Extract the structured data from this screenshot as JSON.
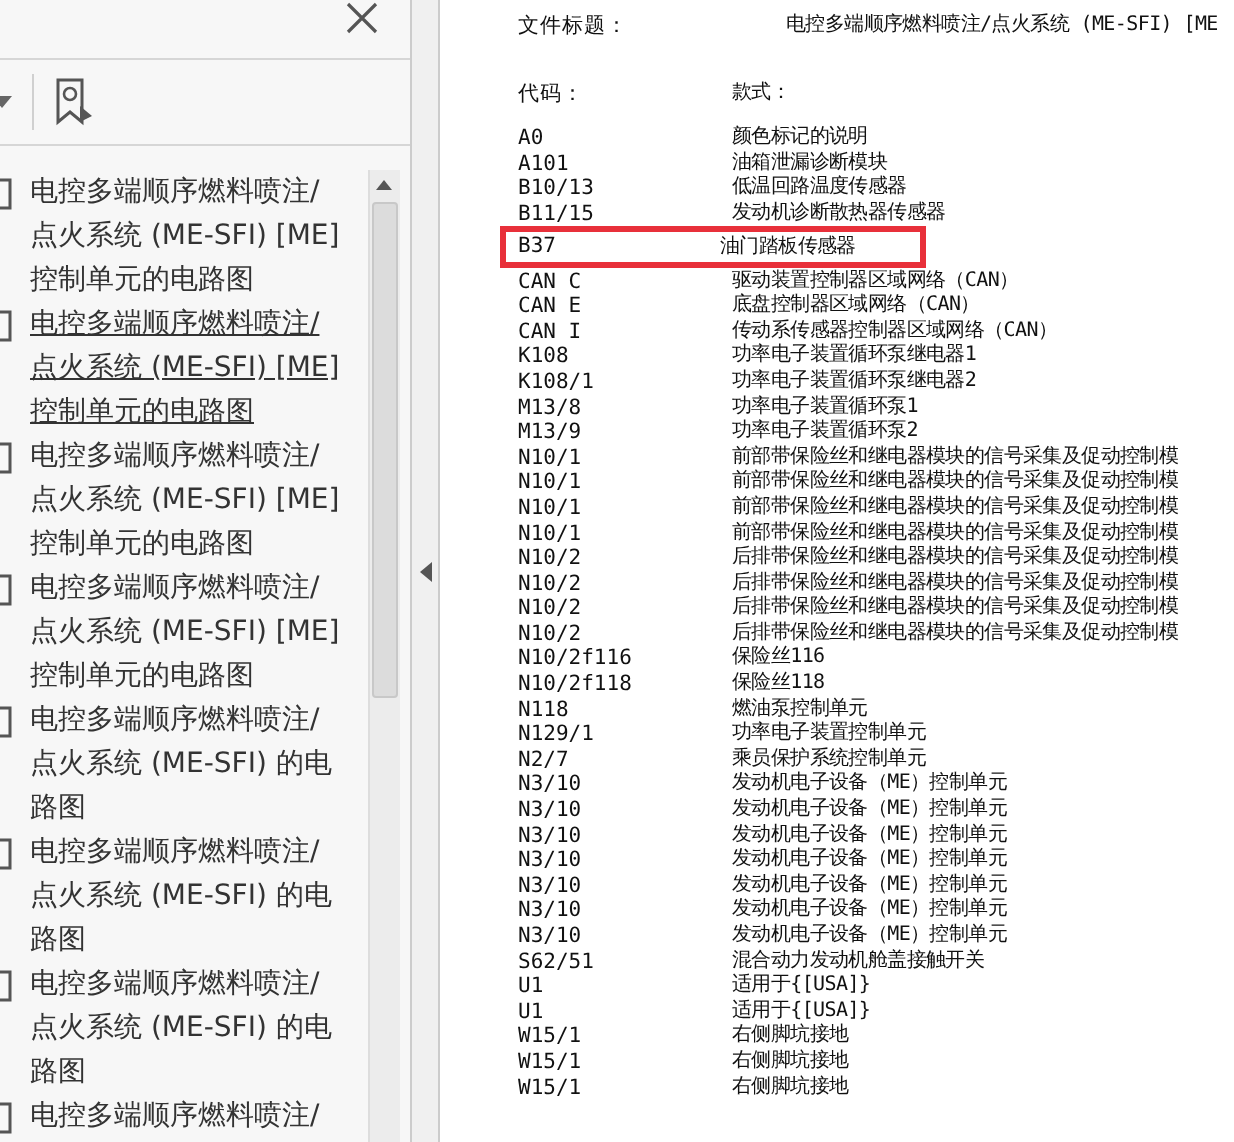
{
  "sidebar": {
    "bookmarks": [
      {
        "lines": [
          "电控多端顺序燃料喷注/",
          "点火系统 (ME-SFI) [ME]",
          "控制单元的电路图"
        ],
        "selected": false
      },
      {
        "lines": [
          "电控多端顺序燃料喷注/",
          "点火系统 (ME-SFI) [ME]",
          "控制单元的电路图"
        ],
        "selected": true
      },
      {
        "lines": [
          "电控多端顺序燃料喷注/",
          "点火系统 (ME-SFI) [ME]",
          "控制单元的电路图"
        ],
        "selected": false
      },
      {
        "lines": [
          "电控多端顺序燃料喷注/",
          "点火系统 (ME-SFI) [ME]",
          "控制单元的电路图"
        ],
        "selected": false
      },
      {
        "lines": [
          "电控多端顺序燃料喷注/",
          "点火系统 (ME-SFI) 的电",
          "路图"
        ],
        "selected": false
      },
      {
        "lines": [
          "电控多端顺序燃料喷注/",
          "点火系统 (ME-SFI) 的电",
          "路图"
        ],
        "selected": false
      },
      {
        "lines": [
          "电控多端顺序燃料喷注/",
          "点火系统 (ME-SFI) 的电",
          "路图"
        ],
        "selected": false
      },
      {
        "lines": [
          "电控多端顺序燃料喷注/"
        ],
        "selected": false
      }
    ]
  },
  "document": {
    "title_label": "文件标题：",
    "title_value": "电控多端顺序燃料喷注/点火系统 (ME-SFI) [ME",
    "columns": [
      "代码：",
      "款式："
    ],
    "rows": [
      {
        "code": "A0",
        "name": "颜色标记的说明",
        "highlighted": false
      },
      {
        "code": "A101",
        "name": "油箱泄漏诊断模块",
        "highlighted": false
      },
      {
        "code": "B10/13",
        "name": "低温回路温度传感器",
        "highlighted": false
      },
      {
        "code": "B11/15",
        "name": "发动机诊断散热器传感器",
        "highlighted": false
      },
      {
        "code": "B37",
        "name": "油门踏板传感器",
        "highlighted": true
      },
      {
        "code": "CAN C",
        "name": "驱动装置控制器区域网络（CAN）",
        "highlighted": false
      },
      {
        "code": "CAN E",
        "name": "底盘控制器区域网络（CAN）",
        "highlighted": false
      },
      {
        "code": "CAN I",
        "name": "传动系传感器控制器区域网络（CAN）",
        "highlighted": false
      },
      {
        "code": "K108",
        "name": "功率电子装置循环泵继电器1",
        "highlighted": false
      },
      {
        "code": "K108/1",
        "name": "功率电子装置循环泵继电器2",
        "highlighted": false
      },
      {
        "code": "M13/8",
        "name": "功率电子装置循环泵1",
        "highlighted": false
      },
      {
        "code": "M13/9",
        "name": "功率电子装置循环泵2",
        "highlighted": false
      },
      {
        "code": "N10/1",
        "name": "前部带保险丝和继电器模块的信号采集及促动控制模",
        "highlighted": false
      },
      {
        "code": "N10/1",
        "name": "前部带保险丝和继电器模块的信号采集及促动控制模",
        "highlighted": false
      },
      {
        "code": "N10/1",
        "name": "前部带保险丝和继电器模块的信号采集及促动控制模",
        "highlighted": false
      },
      {
        "code": "N10/1",
        "name": "前部带保险丝和继电器模块的信号采集及促动控制模",
        "highlighted": false
      },
      {
        "code": "N10/2",
        "name": "后排带保险丝和继电器模块的信号采集及促动控制模",
        "highlighted": false
      },
      {
        "code": "N10/2",
        "name": "后排带保险丝和继电器模块的信号采集及促动控制模",
        "highlighted": false
      },
      {
        "code": "N10/2",
        "name": "后排带保险丝和继电器模块的信号采集及促动控制模",
        "highlighted": false
      },
      {
        "code": "N10/2",
        "name": "后排带保险丝和继电器模块的信号采集及促动控制模",
        "highlighted": false
      },
      {
        "code": "N10/2f116",
        "name": "保险丝116",
        "highlighted": false
      },
      {
        "code": "N10/2f118",
        "name": "保险丝118",
        "highlighted": false
      },
      {
        "code": "N118",
        "name": "燃油泵控制单元",
        "highlighted": false
      },
      {
        "code": "N129/1",
        "name": "功率电子装置控制单元",
        "highlighted": false
      },
      {
        "code": "N2/7",
        "name": "乘员保护系统控制单元",
        "highlighted": false
      },
      {
        "code": "N3/10",
        "name": "发动机电子设备（ME）控制单元",
        "highlighted": false
      },
      {
        "code": "N3/10",
        "name": "发动机电子设备（ME）控制单元",
        "highlighted": false
      },
      {
        "code": "N3/10",
        "name": "发动机电子设备（ME）控制单元",
        "highlighted": false
      },
      {
        "code": "N3/10",
        "name": "发动机电子设备（ME）控制单元",
        "highlighted": false
      },
      {
        "code": "N3/10",
        "name": "发动机电子设备（ME）控制单元",
        "highlighted": false
      },
      {
        "code": "N3/10",
        "name": "发动机电子设备（ME）控制单元",
        "highlighted": false
      },
      {
        "code": "N3/10",
        "name": "发动机电子设备（ME）控制单元",
        "highlighted": false
      },
      {
        "code": "S62/51",
        "name": "混合动力发动机舱盖接触开关",
        "highlighted": false
      },
      {
        "code": "U1",
        "name": "适用于{[USA]}",
        "highlighted": false
      },
      {
        "code": "U1",
        "name": "适用于{[USA]}",
        "highlighted": false
      },
      {
        "code": "W15/1",
        "name": "右侧脚坑接地",
        "highlighted": false
      },
      {
        "code": "W15/1",
        "name": "右侧脚坑接地",
        "highlighted": false
      },
      {
        "code": "W15/1",
        "name": "右侧脚坑接地",
        "highlighted": false
      }
    ]
  }
}
